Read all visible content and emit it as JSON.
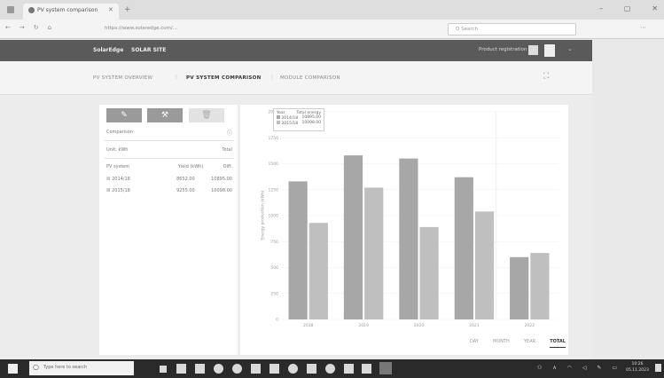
{
  "browser": {
    "tab_title": "PV system comparison",
    "url": "https://www.solaredge.com/...",
    "search_placeholder": "Q Search"
  },
  "app": {
    "logo": "SolarEdge",
    "site_name": "SOLAR SITE",
    "user_label": "Product registration"
  },
  "nav": {
    "tabs": [
      "PV SYSTEM OVERVIEW",
      "PV SYSTEM COMPARISON",
      "MODULE COMPARISON"
    ],
    "active_index": 1
  },
  "left_panel": {
    "tool_buttons": [
      "pencil-icon",
      "wrench-icon",
      "trash-icon"
    ],
    "comparison_label": "Comparison",
    "unit_label": "Unit: kWh",
    "unit_value": "Total",
    "table_headers": [
      "PV system",
      "Yield (kWh)",
      "Diff."
    ],
    "rows": [
      {
        "name": "2014/18",
        "yield": "8652.00",
        "diff": "10895.00"
      },
      {
        "name": "2015/18",
        "yield": "9255.00",
        "diff": "10098.00"
      }
    ]
  },
  "chart_data": {
    "type": "bar",
    "categories": [
      "2018",
      "2019",
      "2020",
      "2021",
      "2022"
    ],
    "series": [
      {
        "name": "2014/18",
        "values": [
          1330,
          1580,
          1550,
          1370,
          600
        ],
        "color": "#a7a7a7"
      },
      {
        "name": "2015/18",
        "values": [
          930,
          1270,
          890,
          1040,
          640
        ],
        "color": "#bfbfbf"
      }
    ],
    "ylabel": "Energy production (kWh)",
    "ylim": [
      0,
      2000
    ],
    "yticks": [
      0,
      250,
      500,
      750,
      1000,
      1250,
      1500,
      1750,
      2000
    ],
    "legend": {
      "header": [
        "Year",
        "Total energy"
      ],
      "entries": [
        {
          "name": "2014/18",
          "value": "10895.00"
        },
        {
          "name": "2015/18",
          "value": "10098.00"
        }
      ],
      "placement": "top-left"
    },
    "period_options": [
      "DAY",
      "MONTH",
      "YEAR",
      "TOTAL"
    ],
    "active_period": "TOTAL"
  },
  "taskbar": {
    "search_placeholder": "Type here to search",
    "time": "10:26",
    "date": "05.11.2023"
  },
  "colors": {
    "header_bg": "#5a5a5a",
    "taskbar_bg": "#2a2a2a",
    "tool_button_bg": "#9a9a9a"
  }
}
